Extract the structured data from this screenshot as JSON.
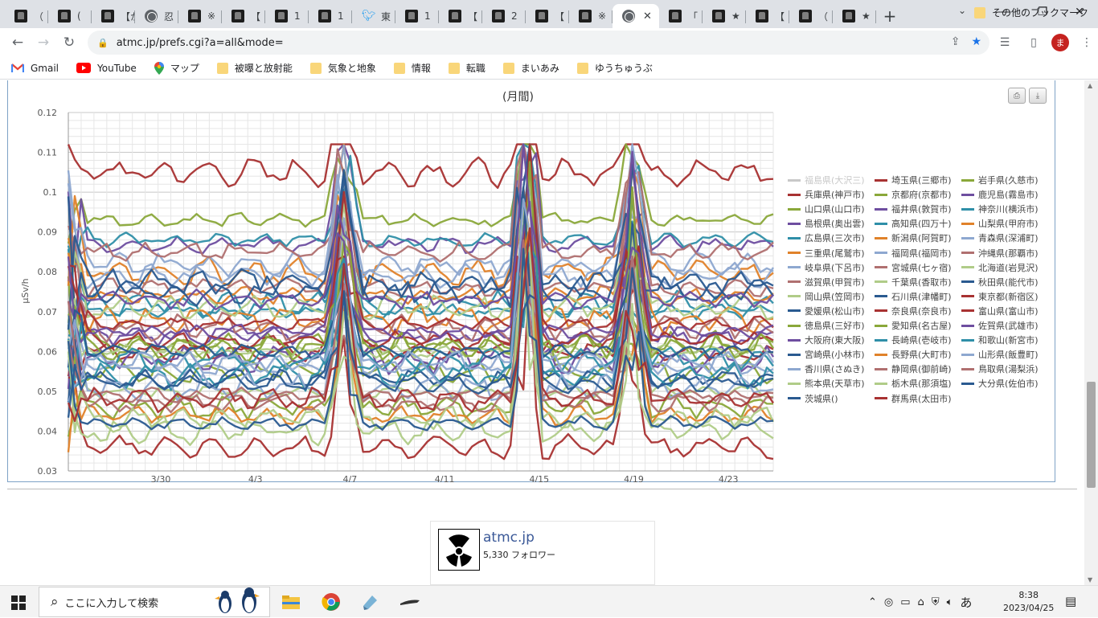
{
  "browser": {
    "tabs": [
      {
        "title": "（",
        "icon": "site"
      },
      {
        "title": "(",
        "icon": "site"
      },
      {
        "title": "【か",
        "icon": "site"
      },
      {
        "title": "忍",
        "icon": "globe"
      },
      {
        "title": "※",
        "icon": "site"
      },
      {
        "title": "【",
        "icon": "site"
      },
      {
        "title": "1",
        "icon": "site"
      },
      {
        "title": "1",
        "icon": "site"
      },
      {
        "title": "東",
        "icon": "twitter"
      },
      {
        "title": "1",
        "icon": "site"
      },
      {
        "title": "【",
        "icon": "site"
      },
      {
        "title": "2",
        "icon": "site"
      },
      {
        "title": "【",
        "icon": "site"
      },
      {
        "title": "※",
        "icon": "site"
      },
      {
        "title": "",
        "icon": "globe",
        "active": true
      },
      {
        "title": "「",
        "icon": "site"
      },
      {
        "title": "★",
        "icon": "site"
      },
      {
        "title": "【",
        "icon": "site"
      },
      {
        "title": "（",
        "icon": "site"
      },
      {
        "title": "★",
        "icon": "site"
      }
    ],
    "new_tab_label": "+",
    "url": "atmc.jp/prefs.cgi?a=all&mode=",
    "profile_initial": "ま",
    "bookmarks": [
      {
        "label": "Gmail",
        "icon": "gmail"
      },
      {
        "label": "YouTube",
        "icon": "youtube"
      },
      {
        "label": "マップ",
        "icon": "maps"
      },
      {
        "label": "被曝と放射能",
        "icon": "folder"
      },
      {
        "label": "気象と地象",
        "icon": "folder"
      },
      {
        "label": "情報",
        "icon": "folder"
      },
      {
        "label": "転職",
        "icon": "folder"
      },
      {
        "label": "まいあみ",
        "icon": "folder"
      },
      {
        "label": "ゆうちゅうぶ",
        "icon": "folder"
      }
    ],
    "other_bookmarks": "その他のブックマーク"
  },
  "chart_data": {
    "type": "line",
    "title": "(月間)",
    "ylabel": "μSv/h",
    "xlabel": "",
    "ylim": [
      0.03,
      0.12
    ],
    "yticks": [
      "0.12",
      "0.11",
      "0.1",
      "0.09",
      "0.08",
      "0.07",
      "0.06",
      "0.05",
      "0.04",
      "0.03"
    ],
    "xticks": [
      "3/30",
      "4/3",
      "4/7",
      "4/11",
      "4/15",
      "4/19",
      "4/23"
    ],
    "grid": true,
    "legend_position": "right",
    "series": [
      {
        "name": "福島県(大沢三)",
        "color": "#c8c8c8",
        "hidden": true,
        "base": 0.0
      },
      {
        "name": "埼玉県(三郷市)",
        "color": "#a83232",
        "base": 0.06
      },
      {
        "name": "岩手県(久慈市)",
        "color": "#8aa83a",
        "base": 0.055
      },
      {
        "name": "兵庫県(神戸市)",
        "color": "#a83232",
        "base": 0.105
      },
      {
        "name": "京都府(京都市)",
        "color": "#8aa83a",
        "base": 0.093
      },
      {
        "name": "鹿児島(霧島市)",
        "color": "#6e4ea0",
        "base": 0.087
      },
      {
        "name": "山口県(山口市)",
        "color": "#8aa83a",
        "base": 0.062
      },
      {
        "name": "福井県(敦賀市)",
        "color": "#6e4ea0",
        "base": 0.058
      },
      {
        "name": "神奈川(横浜市)",
        "color": "#2f8fa8",
        "base": 0.088
      },
      {
        "name": "島根県(奥出雲)",
        "color": "#6e4ea0",
        "base": 0.064
      },
      {
        "name": "高知県(四万十)",
        "color": "#2f8fa8",
        "base": 0.072
      },
      {
        "name": "山梨県(甲府市)",
        "color": "#e0822a",
        "base": 0.08
      },
      {
        "name": "広島県(三次市)",
        "color": "#2f8fa8",
        "base": 0.07
      },
      {
        "name": "新潟県(阿賀町)",
        "color": "#e0822a",
        "base": 0.074
      },
      {
        "name": "青森県(深浦町)",
        "color": "#8ea8d0",
        "base": 0.082
      },
      {
        "name": "三重県(尾鷲市)",
        "color": "#e0822a",
        "base": 0.068
      },
      {
        "name": "福岡県(福岡市)",
        "color": "#8ea8d0",
        "base": 0.056
      },
      {
        "name": "沖縄県(那覇市)",
        "color": "#b07070",
        "base": 0.085
      },
      {
        "name": "岐阜県(下呂市)",
        "color": "#8ea8d0",
        "base": 0.079
      },
      {
        "name": "宮城県(七ヶ宿)",
        "color": "#b07070",
        "base": 0.066
      },
      {
        "name": "北海道(岩見沢)",
        "color": "#b0cc88",
        "base": 0.05
      },
      {
        "name": "滋賀県(甲賀市)",
        "color": "#b07070",
        "base": 0.076
      },
      {
        "name": "千葉県(香取市)",
        "color": "#b0cc88",
        "base": 0.071
      },
      {
        "name": "秋田県(能代市)",
        "color": "#2a5a90",
        "base": 0.077
      },
      {
        "name": "岡山県(笠岡市)",
        "color": "#b0cc88",
        "base": 0.06
      },
      {
        "name": "石川県(津幡町)",
        "color": "#2a5a90",
        "base": 0.053
      },
      {
        "name": "東京都(新宿区)",
        "color": "#a83232",
        "base": 0.036
      },
      {
        "name": "愛媛県(松山市)",
        "color": "#2a5a90",
        "base": 0.075
      },
      {
        "name": "奈良県(奈良市)",
        "color": "#a83232",
        "base": 0.067
      },
      {
        "name": "富山県(富山市)",
        "color": "#a83232",
        "base": 0.063
      },
      {
        "name": "徳島県(三好市)",
        "color": "#8aa83a",
        "base": 0.046
      },
      {
        "name": "愛知県(名古屋)",
        "color": "#8aa83a",
        "base": 0.061
      },
      {
        "name": "佐賀県(武雄市)",
        "color": "#6e4ea0",
        "base": 0.065
      },
      {
        "name": "大阪府(東大阪)",
        "color": "#6e4ea0",
        "base": 0.073
      },
      {
        "name": "長崎県(壱岐市)",
        "color": "#2f8fa8",
        "base": 0.058
      },
      {
        "name": "和歌山(新宮市)",
        "color": "#2f8fa8",
        "base": 0.054
      },
      {
        "name": "宮崎県(小林市)",
        "color": "#2a5a90",
        "base": 0.06
      },
      {
        "name": "長野県(大町市)",
        "color": "#e0822a",
        "base": 0.044
      },
      {
        "name": "山形県(飯豊町)",
        "color": "#8ea8d0",
        "base": 0.057
      },
      {
        "name": "香川県(さぬき)",
        "color": "#8ea8d0",
        "base": 0.051
      },
      {
        "name": "静岡県(御前崎)",
        "color": "#b07070",
        "base": 0.049
      },
      {
        "name": "鳥取県(湯梨浜)",
        "color": "#b07070",
        "base": 0.047
      },
      {
        "name": "熊本県(天草市)",
        "color": "#b0cc88",
        "base": 0.043
      },
      {
        "name": "栃木県(那須塩)",
        "color": "#b0cc88",
        "base": 0.04
      },
      {
        "name": "大分県(佐伯市)",
        "color": "#2a5a90",
        "base": 0.042
      },
      {
        "name": "茨城県()",
        "color": "#2a5a90",
        "base": 0.052
      },
      {
        "name": "群馬県(太田市)",
        "color": "#a83232",
        "base": 0.048
      }
    ]
  },
  "widget": {
    "name": "atmc.jp",
    "followers": "5,330 フォロワー"
  },
  "taskbar": {
    "search_placeholder": "ここに入力して検索",
    "time": "8:38",
    "date": "2023/04/25",
    "ime": "あ"
  }
}
